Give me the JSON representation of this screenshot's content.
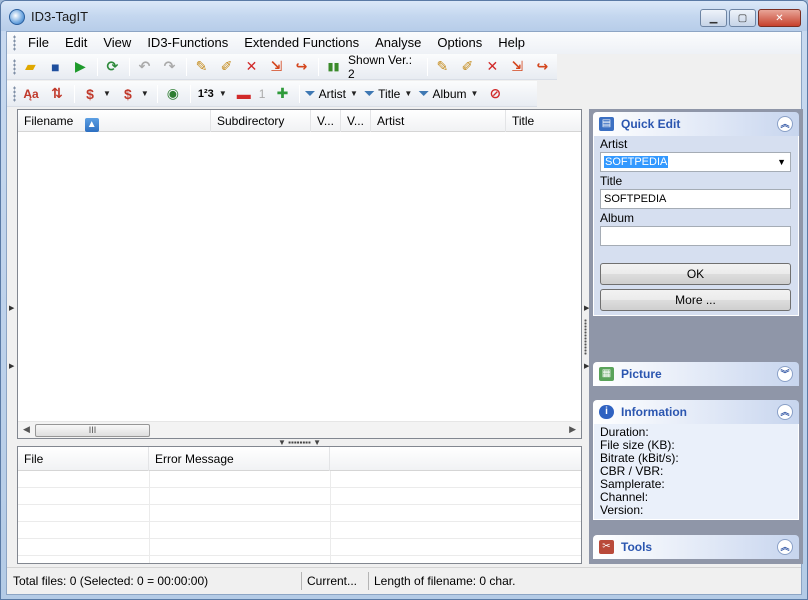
{
  "window": {
    "title": "ID3-TagIT"
  },
  "menu": [
    "File",
    "Edit",
    "View",
    "ID3-Functions",
    "Extended Functions",
    "Analyse",
    "Options",
    "Help"
  ],
  "toolbar1": {
    "shown_version": "Shown Ver.: 2"
  },
  "toolbar2": {
    "counter_label": "1",
    "filters": [
      "Artist",
      "Title",
      "Album"
    ]
  },
  "filelist": {
    "columns": [
      "Filename",
      "Subdirectory",
      "V...",
      "V...",
      "Artist",
      "Title"
    ],
    "scroll_thumb": "III"
  },
  "errorlist": {
    "columns": [
      "File",
      "Error Message"
    ]
  },
  "quick_edit": {
    "title": "Quick Edit",
    "artist_label": "Artist",
    "artist_value": "SOFTPEDIA",
    "title_label": "Title",
    "title_value": "SOFTPEDIA",
    "album_label": "Album",
    "album_value": "",
    "ok_label": "OK",
    "more_label": "More ..."
  },
  "picture": {
    "title": "Picture"
  },
  "information": {
    "title": "Information",
    "fields": [
      "Duration:",
      "File size (KB):",
      "Bitrate (kBit/s):",
      "CBR / VBR:",
      "Samplerate:",
      "Channel:",
      "Version:"
    ]
  },
  "tools": {
    "title": "Tools"
  },
  "status": {
    "total": "Total files: 0 (Selected: 0 = 00:00:00)",
    "current": "Current...",
    "length": "Length of filename: 0 char."
  },
  "colors": {
    "accent": "#2b56b0",
    "panel_bg": "#d6dff0"
  }
}
